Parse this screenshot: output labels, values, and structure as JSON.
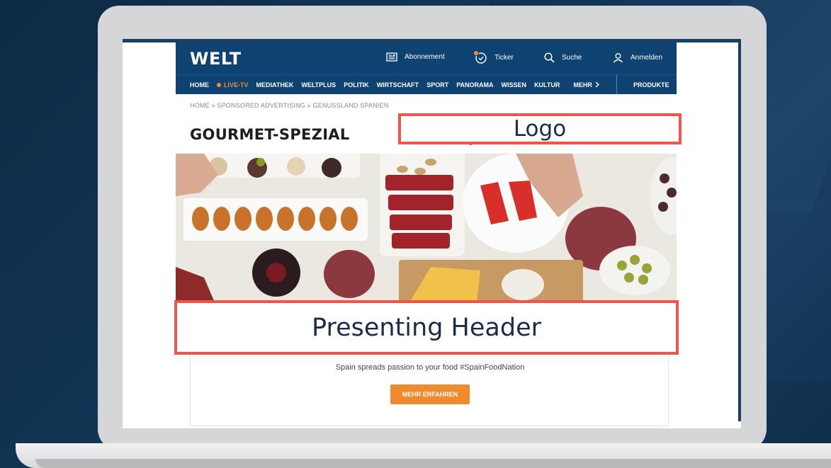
{
  "site": {
    "logo_text": "WELT",
    "header_links": {
      "subscription": "Abonnement",
      "ticker": "Ticker",
      "search": "Suche",
      "login": "Anmelden"
    },
    "nav": {
      "items": [
        "HOME",
        "LIVE-TV",
        "MEDIATHEK",
        "WELTPLUS",
        "POLITIK",
        "WIRTSCHAFT",
        "SPORT",
        "PANORAMA",
        "WISSEN",
        "KULTUR"
      ],
      "more": "MEHR",
      "products": "PRODUKTE"
    },
    "breadcrumb": "HOME » SPONSORED ADVERTISING » GENUSSLAND SPANIEN",
    "page_title": "GOURMET-SPEZIAL",
    "tagline": "Spain spreads passion to your food #SpainFoodNation",
    "cta_label": "MEHR ERFAHREN"
  },
  "annotations": {
    "logo_label": "Logo",
    "header_label": "Presenting Header"
  },
  "colors": {
    "brand_blue": "#0d4271",
    "accent_orange": "#ef8a2e",
    "annotation_red": "#f0544a"
  }
}
